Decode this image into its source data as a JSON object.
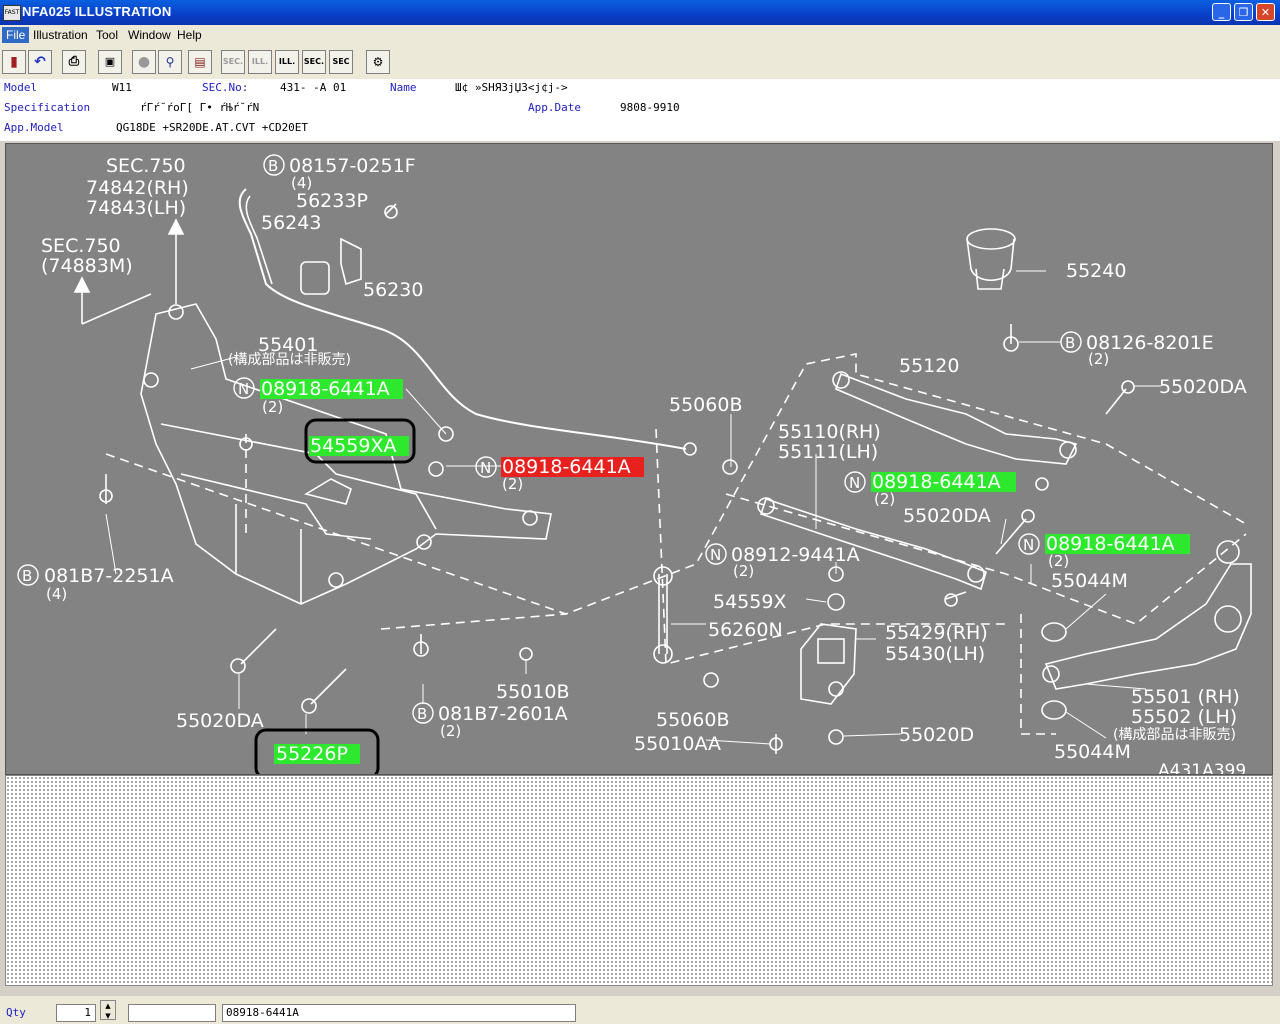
{
  "window": {
    "title": "NFA025  ILLUSTRATION",
    "app_icon": "FAST"
  },
  "menu": [
    "File",
    "Illustration",
    "Tool",
    "Window",
    "Help"
  ],
  "toolbar": {
    "sec1": "SEC.",
    "ill1": "ILL.",
    "ill2": "ILL.",
    "sec2": "SEC.",
    "sec3": "SEC"
  },
  "info": {
    "model_label": "Model",
    "model_value": "W11",
    "secno_label": "SEC.No:",
    "secno_value": "431-  -A 01",
    "name_label": "Name",
    "name_value": "Ш¢ »SHЯЗjЏЗ<j¢j->",
    "spec_label": "Specification",
    "spec_value": "ŕГŕ˘ŕoГ[  Г•  ŕЊŕ˘ŕN",
    "appdate_label": "App.Date",
    "appdate_value": "9808-9910",
    "appmodel_label": "App.Model",
    "appmodel_value": "QG18DE +SR20DE.AT.CVT +CD20ET"
  },
  "illustration": {
    "labels": {
      "sec750a": "SEC.750",
      "l74842": "74842(RH)",
      "l74843": "74843(LH)",
      "sec750b": "SEC.750",
      "l74883": "(74883M)",
      "b1": "08157-0251F",
      "b1q": "(4)",
      "p56233": "56233P",
      "p56243": "56243",
      "p56230": "56230",
      "p55401": "55401",
      "note1": "(構成部品は非販売)",
      "n1": "08918-6441A",
      "n1q": "(2)",
      "hl1": "54559XA",
      "n2": "08918-6441A",
      "n2q": "(2)",
      "b2": "081B7-2251A",
      "b2q": "(4)",
      "p55020da_l": "55020DA",
      "hl2": "55226P",
      "b3": "081B7-2601A",
      "b3q": "(2)",
      "p55010b": "55010B",
      "p55060b_t": "55060B",
      "p55110": "55110(RH)",
      "p55111": "55111(LH)",
      "n3": "08912-9441A",
      "n3q": "(2)",
      "p54559x": "54559X",
      "p56260n": "56260N",
      "p55060b_b": "55060B",
      "p55010aa": "55010AA",
      "p55429": "55429(RH)",
      "p55430": "55430(LH)",
      "p55020d": "55020D",
      "p55240": "55240",
      "b4": "08126-8201E",
      "b4q": "(2)",
      "p55120": "55120",
      "p55020da_r": "55020DA",
      "n4": "08918-6441A",
      "n4q": "(2)",
      "p55020da_m": "55020DA",
      "n5": "08918-6441A",
      "n5q": "(2)",
      "p55044m_t": "55044M",
      "p55501": "55501 (RH)",
      "p55502": "55502 (LH)",
      "note2": "(構成部品は非販売)",
      "p55044m_b": "55044M",
      "code": "A431A399",
      "circle_b": "B",
      "circle_n": "N"
    },
    "colors": {
      "canvas": "#838383",
      "line": "#ffffff",
      "highlight": "#2ee82e",
      "selected": "#e8201e",
      "ink": "#000000"
    }
  },
  "status": {
    "qty_label": "Qty",
    "qty_value": "1",
    "field2": "",
    "part_value": "08918-6441A"
  }
}
